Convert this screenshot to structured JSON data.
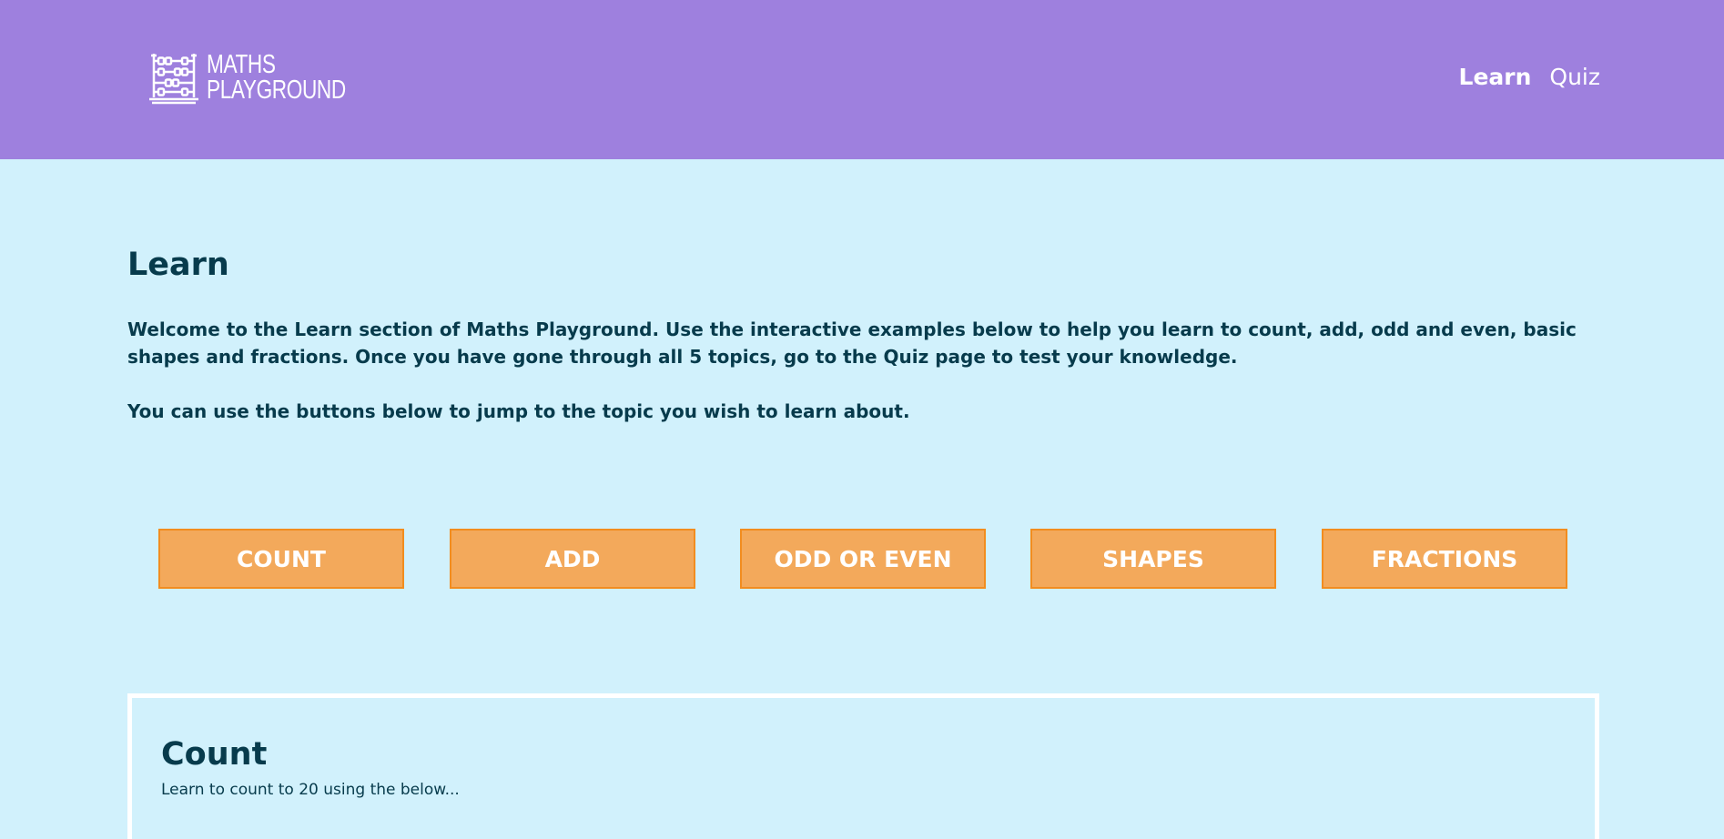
{
  "header": {
    "logo": {
      "icon": "abacus-icon",
      "line1": "MATHS",
      "line2": "PLAYGROUND"
    },
    "nav": {
      "learn": "Learn",
      "quiz": "Quiz"
    }
  },
  "main": {
    "title": "Learn",
    "intro": "Welcome to the Learn section of Maths Playground. Use the interactive examples below to help you learn to count, add, odd and even, basic shapes and fractions. Once you have gone through all 5 topics, go to the Quiz page to test your knowledge.",
    "jump_text": "You can use the buttons below to jump to the topic you wish to learn about.",
    "buttons": {
      "count": "COUNT",
      "add": "ADD",
      "odd_even": "ODD OR EVEN",
      "shapes": "SHAPES",
      "fractions": "FRACTIONS"
    },
    "count_section": {
      "title": "Count",
      "subtitle": "Learn to count to 20 using the below..."
    }
  },
  "colors": {
    "header_bg": "#9e80de",
    "page_bg": "#d1f1fc",
    "text": "#073b4c",
    "button_bg": "#f3a95b",
    "button_border": "#f28d1f"
  }
}
